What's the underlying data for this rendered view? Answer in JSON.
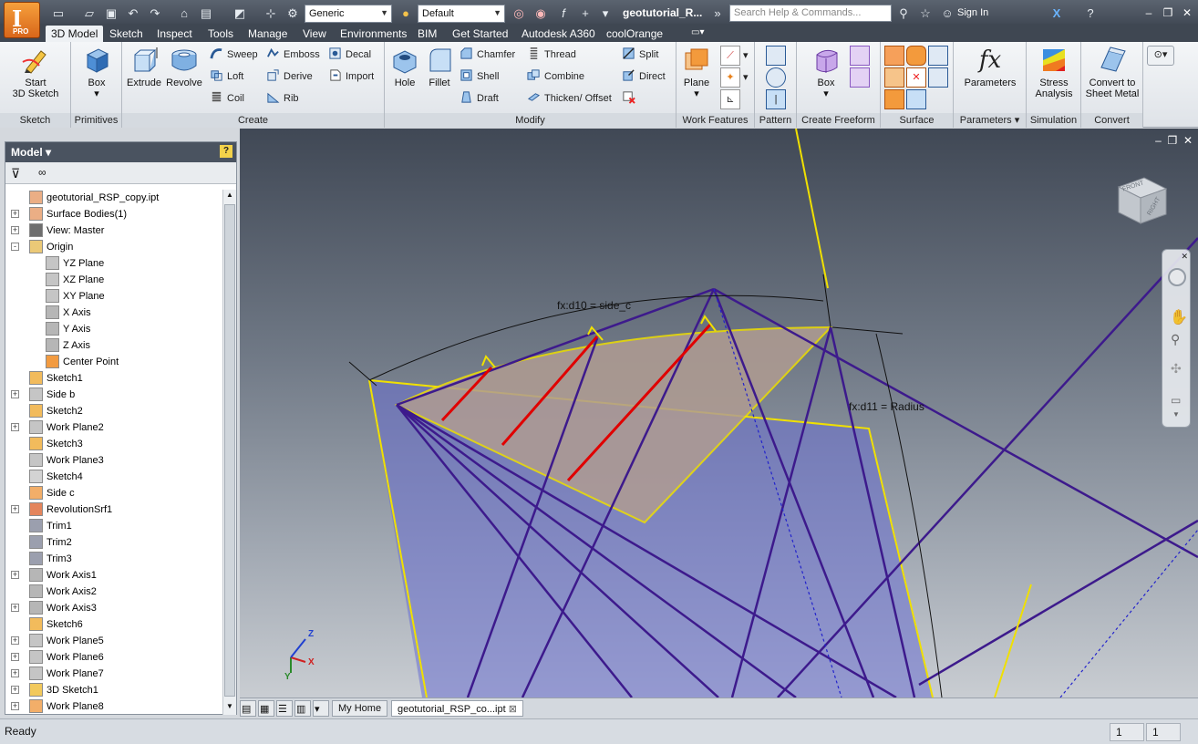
{
  "title_bar": {
    "app_label": "PRO",
    "material_combo": "Generic",
    "appearance_combo": "Default",
    "doc_title": "geotutorial_R...",
    "search_placeholder": "Search Help & Commands...",
    "sign_in": "Sign In"
  },
  "tabs": [
    {
      "label": "3D Model",
      "active": true
    },
    {
      "label": "Sketch"
    },
    {
      "label": "Inspect"
    },
    {
      "label": "Tools"
    },
    {
      "label": "Manage"
    },
    {
      "label": "View"
    },
    {
      "label": "Environments"
    },
    {
      "label": "BIM"
    },
    {
      "label": "Get Started"
    },
    {
      "label": "Autodesk A360"
    },
    {
      "label": "coolOrange"
    }
  ],
  "ribbon": {
    "sketch": {
      "title": "Sketch",
      "start_line1": "Start",
      "start_line2": "3D Sketch"
    },
    "primitives": {
      "title": "Primitives",
      "box": "Box"
    },
    "create": {
      "title": "Create",
      "extrude": "Extrude",
      "revolve": "Revolve",
      "sweep": "Sweep",
      "loft": "Loft",
      "coil": "Coil",
      "emboss": "Emboss",
      "derive": "Derive",
      "rib": "Rib",
      "decal": "Decal",
      "import": "Import"
    },
    "modify": {
      "title": "Modify",
      "hole": "Hole",
      "fillet": "Fillet",
      "chamfer": "Chamfer",
      "shell": "Shell",
      "draft": "Draft",
      "thread": "Thread",
      "combine": "Combine",
      "thicken": "Thicken/ Offset",
      "split": "Split",
      "direct": "Direct"
    },
    "work_features": {
      "title": "Work Features",
      "plane": "Plane"
    },
    "pattern": {
      "title": "Pattern"
    },
    "freeform": {
      "title": "Create Freeform",
      "box": "Box"
    },
    "surface": {
      "title": "Surface"
    },
    "parameters": {
      "title": "Parameters",
      "label": "Parameters"
    },
    "simulation": {
      "title": "Simulation",
      "line1": "Stress",
      "line2": "Analysis"
    },
    "convert": {
      "title": "Convert",
      "line1": "Convert to",
      "line2": "Sheet Metal"
    }
  },
  "browser": {
    "title": "Model",
    "tree": [
      {
        "label": "geotutorial_RSP_copy.ipt",
        "level": 0,
        "expander": "",
        "icon": "part-icon"
      },
      {
        "label": "Surface Bodies(1)",
        "level": 0,
        "expander": "+",
        "icon": "surface-bodies-icon"
      },
      {
        "label": "View: Master",
        "level": 0,
        "expander": "+",
        "icon": "view-icon"
      },
      {
        "label": "Origin",
        "level": 0,
        "expander": "-",
        "icon": "folder-icon"
      },
      {
        "label": "YZ Plane",
        "level": 1,
        "expander": "",
        "icon": "plane-icon"
      },
      {
        "label": "XZ Plane",
        "level": 1,
        "expander": "",
        "icon": "plane-icon"
      },
      {
        "label": "XY Plane",
        "level": 1,
        "expander": "",
        "icon": "plane-icon"
      },
      {
        "label": "X Axis",
        "level": 1,
        "expander": "",
        "icon": "axis-icon"
      },
      {
        "label": "Y Axis",
        "level": 1,
        "expander": "",
        "icon": "axis-icon"
      },
      {
        "label": "Z Axis",
        "level": 1,
        "expander": "",
        "icon": "axis-icon"
      },
      {
        "label": "Center Point",
        "level": 1,
        "expander": "",
        "icon": "point-icon"
      },
      {
        "label": "Sketch1",
        "level": 0,
        "expander": "",
        "icon": "sketch-icon"
      },
      {
        "label": "Side b",
        "level": 0,
        "expander": "+",
        "icon": "plane-icon"
      },
      {
        "label": "Sketch2",
        "level": 0,
        "expander": "",
        "icon": "sketch-icon"
      },
      {
        "label": "Work Plane2",
        "level": 0,
        "expander": "+",
        "icon": "plane-icon"
      },
      {
        "label": "Sketch3",
        "level": 0,
        "expander": "",
        "icon": "sketch-icon"
      },
      {
        "label": "Work Plane3",
        "level": 0,
        "expander": "",
        "icon": "plane-icon"
      },
      {
        "label": "Sketch4",
        "level": 0,
        "expander": "",
        "icon": "sketch-grey-icon"
      },
      {
        "label": "Side c",
        "level": 0,
        "expander": "",
        "icon": "face-icon"
      },
      {
        "label": "RevolutionSrf1",
        "level": 0,
        "expander": "+",
        "icon": "revolve-icon"
      },
      {
        "label": "Trim1",
        "level": 0,
        "expander": "",
        "icon": "trim-icon"
      },
      {
        "label": "Trim2",
        "level": 0,
        "expander": "",
        "icon": "trim-icon"
      },
      {
        "label": "Trim3",
        "level": 0,
        "expander": "",
        "icon": "trim-icon"
      },
      {
        "label": "Work Axis1",
        "level": 0,
        "expander": "+",
        "icon": "axis-icon"
      },
      {
        "label": "Work Axis2",
        "level": 0,
        "expander": "",
        "icon": "axis-icon"
      },
      {
        "label": "Work Axis3",
        "level": 0,
        "expander": "+",
        "icon": "axis-icon"
      },
      {
        "label": "Sketch6",
        "level": 0,
        "expander": "",
        "icon": "sketch-icon"
      },
      {
        "label": "Work Plane5",
        "level": 0,
        "expander": "+",
        "icon": "plane-icon"
      },
      {
        "label": "Work Plane6",
        "level": 0,
        "expander": "+",
        "icon": "plane-icon"
      },
      {
        "label": "Work Plane7",
        "level": 0,
        "expander": "+",
        "icon": "plane-icon"
      },
      {
        "label": "3D Sketch1",
        "level": 0,
        "expander": "+",
        "icon": "sketch3d-icon"
      },
      {
        "label": "Work Plane8",
        "level": 0,
        "expander": "+",
        "icon": "face-icon"
      }
    ]
  },
  "viewport": {
    "dim1": "fx:d10 = side_c",
    "dim2": "fx:d11 = Radius",
    "viewcube_top": "FRONT",
    "viewcube_right": "RIGHT",
    "triad_x": "X",
    "triad_y": "Y",
    "triad_z": "Z"
  },
  "doc_tabs": {
    "home": "My Home",
    "active": "geotutorial_RSP_co...ipt"
  },
  "status": {
    "text": "Ready",
    "field1": "1",
    "field2": "1"
  },
  "colors": {
    "yellow_edge": "#f0e000",
    "blue_line": "#3d1a8c",
    "red_line": "#e00000",
    "face_fill": "#b09c92"
  }
}
